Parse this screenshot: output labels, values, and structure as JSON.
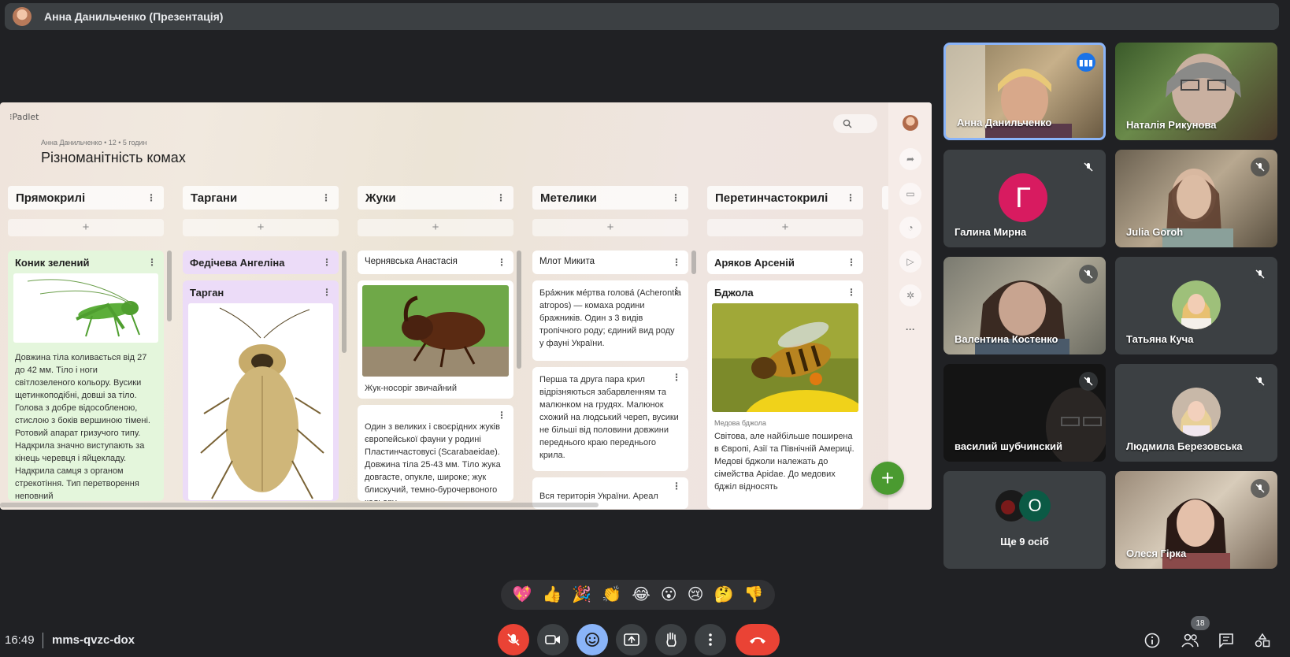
{
  "presenter": {
    "name": "Анна Данильченко (Презентація)"
  },
  "padlet": {
    "logo": "⁝Padlet",
    "meta": "Анна Данильченко • 12 • 5 годин",
    "title": "Різноманітність комах",
    "columns": [
      {
        "title": "Прямокрилі"
      },
      {
        "title": "Таргани"
      },
      {
        "title": "Жуки"
      },
      {
        "title": "Метелики"
      },
      {
        "title": "Перетинчастокрилі"
      }
    ],
    "cards": {
      "c1_title": "Коник зелений",
      "c1_body": "Довжина тіла коливається від 27 до 42 мм. Тіло і ноги світлозеленого кольору. Вусики щетинкоподібні, довші за тіло. Голова з добре відособленою, стислою з боків вершиною тімені. Ротовий апарат гризучого типу. Надкрила значно виступають за кінець черевця і яйцекладу. Надкрила самця з органом стрекотіння. Тип перетворення неповний",
      "c2_author": "Федічева Ангеліна",
      "c2_title": "Тарган",
      "c3_author": "Чернявська Анастасія",
      "c3_caption": "Жук-носоріг звичайний",
      "c3_body": "Один з великих і своєрідних жуків європейської фауни у родині Пластинчастовусі (Scarabaeidae). Довжина тіла 25-43 мм. Тіло жука довгасте, опукле, широке; жук блискучий, темно-бурочервоного кольору,",
      "c4_author": "Млот Микита",
      "c4_body1": "Бра́жник ме́ртва голова́ (Acherontia atropos) — комаха родини бражників. Один з 3 видів тропічного роду; єдиний вид роду у фауні України.",
      "c4_body2": "Перша та друга пара крил відрізняються забарвленням та малюнком на грудях. Малюнок схожий на людський череп, вусики не більші від половини довжини переднього краю переднього крила.",
      "c4_body3": "Вся територія України. Ареал",
      "c5_author": "Аряков Арсеній",
      "c5_title": "Бджола",
      "c5_caption": "Медова бджола",
      "c5_body": "Світова, але найбільше поширена в Європі, Азії та Північній Америці. Медові бджоли належать до сімейства Apidae. До медових бджіл відносять"
    }
  },
  "participants": [
    {
      "name": "Анна Данильченко"
    },
    {
      "name": "Наталія Рикунова"
    },
    {
      "name": "Галина Мирна",
      "letter": "Г"
    },
    {
      "name": "Julia Goroh"
    },
    {
      "name": "Валентина Костенко"
    },
    {
      "name": "Татьяна Куча"
    },
    {
      "name": "василий шубчинский"
    },
    {
      "name": "Людмила Березовська"
    },
    {
      "name": "Ще 9 осіб",
      "letter": "О"
    },
    {
      "name": "Олеся Гірка"
    }
  ],
  "reactions": [
    "💖",
    "👍",
    "🎉",
    "👏",
    "😂",
    "😮",
    "😢",
    "🤔",
    "👎"
  ],
  "bottom": {
    "time": "16:49",
    "meeting_code": "mms-qvzc-dox",
    "participant_count": "18"
  },
  "colors": {
    "background": "#202124",
    "end_call": "#ea4335",
    "active_speaker": "#8ab4f8",
    "fab": "#4a9a30"
  }
}
